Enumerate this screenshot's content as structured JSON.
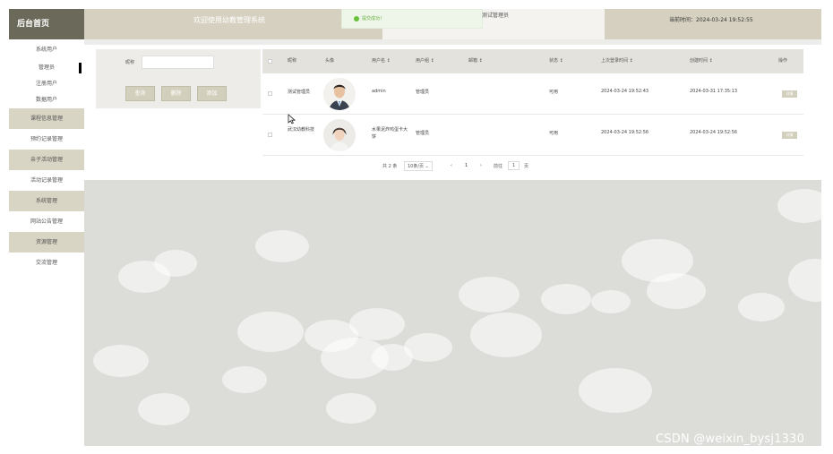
{
  "sidebar": {
    "title": "后台首页",
    "items": [
      {
        "label": "系统用户",
        "style": "plain"
      },
      {
        "label": "管理员",
        "style": "sub",
        "active": true
      },
      {
        "label": "注册用户",
        "style": "sub"
      },
      {
        "label": "数据用户",
        "style": "sub"
      },
      {
        "label": "课程信息管理",
        "style": "dark"
      },
      {
        "label": "预约记录管理",
        "style": "plain"
      },
      {
        "label": "亲子活动管理",
        "style": "dark"
      },
      {
        "label": "活动记录管理",
        "style": "plain"
      },
      {
        "label": "系统管理",
        "style": "dark"
      },
      {
        "label": "网站公告管理",
        "style": "plain"
      },
      {
        "label": "资源管理",
        "style": "dark"
      },
      {
        "label": "交流管理",
        "style": "plain"
      }
    ]
  },
  "header": {
    "title": "欢迎使用幼教管理系统",
    "toast": "提交成功！",
    "admin": "测试管理员",
    "time": "当前时间：2024-03-24 19:52:55"
  },
  "search": {
    "label": "昵称",
    "value": "",
    "buttons": [
      "查询",
      "删除",
      "添加"
    ]
  },
  "table": {
    "headers": [
      "昵称",
      "头像",
      "用户名 ↕",
      "用户组 ↕",
      "邮箱 ↕",
      "状态 ↕",
      "上次登录时间 ↕",
      "创建时间 ↕",
      "操作"
    ],
    "rows": [
      {
        "nickname": "测试管理员",
        "username": "admin",
        "group": "管理员",
        "email": "",
        "status": "可用",
        "last_login": "2024-03-24 19:52:43",
        "created": "2024-03-31 17:35:13",
        "op": "详情"
      },
      {
        "nickname": "武汉幼教科技",
        "username": "水果泥炸鸡蛋卡大饼",
        "group": "管理员",
        "email": "",
        "status": "可用",
        "last_login": "2024-03-24 19:52:56",
        "created": "2024-03-24 19:52:56",
        "op": "详情"
      }
    ]
  },
  "pager": {
    "total": "共 2 条",
    "page_size": "10条/页 ⌄",
    "prev": "‹",
    "current": "1",
    "next": "›",
    "goto_label": "前往",
    "goto_value": "1",
    "page_unit": "页"
  },
  "watermark": "CSDN @weixin_bysj1330",
  "colors": {
    "sidebar_head": "#6b6a5a",
    "header_bg": "#d5d0bf",
    "button_bg": "#d3cfbd",
    "toast_green": "#67c23a"
  }
}
